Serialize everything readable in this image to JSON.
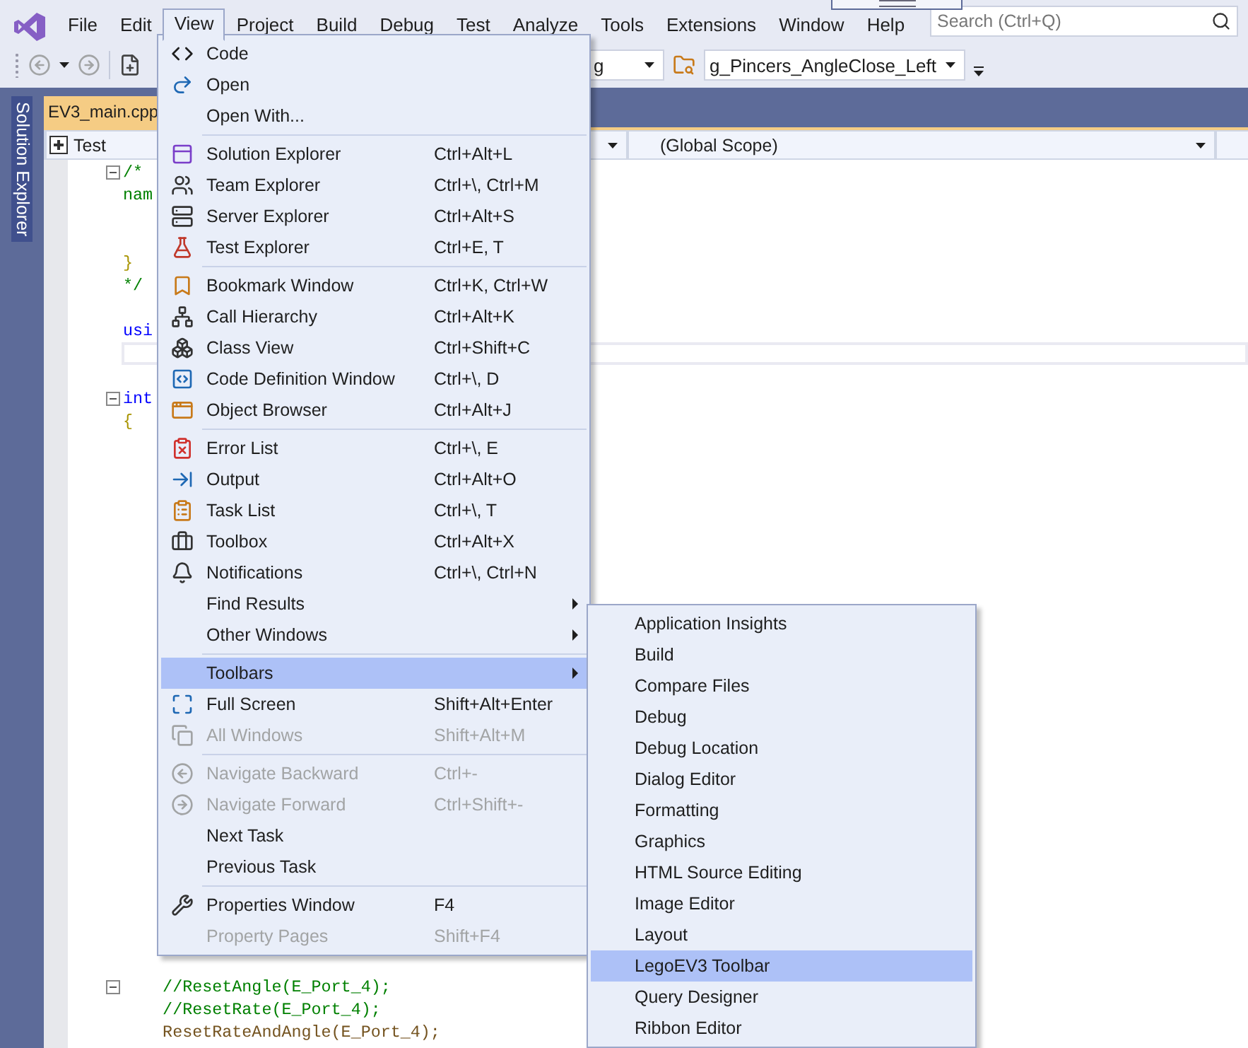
{
  "menubar": {
    "items": [
      {
        "label": "File",
        "selected": false
      },
      {
        "label": "Edit",
        "selected": false
      },
      {
        "label": "View",
        "selected": true
      },
      {
        "label": "Project",
        "selected": false
      },
      {
        "label": "Build",
        "selected": false
      },
      {
        "label": "Debug",
        "selected": false
      },
      {
        "label": "Test",
        "selected": false
      },
      {
        "label": "Analyze",
        "selected": false
      },
      {
        "label": "Tools",
        "selected": false
      },
      {
        "label": "Extensions",
        "selected": false
      },
      {
        "label": "Window",
        "selected": false
      },
      {
        "label": "Help",
        "selected": false
      }
    ]
  },
  "search": {
    "placeholder": "Search (Ctrl+Q)"
  },
  "toolbar": {
    "configuration_dropdown": {
      "value": "g"
    },
    "target_dropdown": {
      "value": "g_Pincers_AngleClose_Left"
    }
  },
  "side_tabs": [
    {
      "label": "Solution Explorer"
    }
  ],
  "document_tabs": [
    {
      "label": "EV3_main.cpp",
      "selected": true
    }
  ],
  "navigation_bar": {
    "project": "Test",
    "scope": "(Global Scope)"
  },
  "editor": {
    "lines": [
      {
        "text": "/*",
        "kind": "comment",
        "foldable": true
      },
      {
        "text": "nam",
        "kind": "comment",
        "foldable": false
      },
      {
        "kind": "blank"
      },
      {
        "kind": "blank"
      },
      {
        "text": "}",
        "kind": "brace",
        "foldable": false
      },
      {
        "text": "*/",
        "kind": "comment",
        "foldable": false
      },
      {
        "kind": "blank"
      },
      {
        "text": "usi",
        "kind": "keyword",
        "foldable": false
      },
      {
        "kind": "cursor"
      },
      {
        "kind": "blank"
      },
      {
        "text": "int",
        "kind": "keyword",
        "foldable": true
      },
      {
        "text": "{",
        "kind": "brace",
        "foldable": false
      },
      {
        "kind": "blank"
      },
      {
        "kind": "blank"
      },
      {
        "kind": "blank"
      },
      {
        "kind": "blank"
      },
      {
        "kind": "blank"
      },
      {
        "kind": "blank"
      },
      {
        "kind": "blank"
      },
      {
        "kind": "blank"
      },
      {
        "kind": "blank"
      },
      {
        "kind": "blank"
      },
      {
        "kind": "blank"
      },
      {
        "kind": "blank"
      },
      {
        "kind": "blank"
      },
      {
        "kind": "blank"
      },
      {
        "kind": "blank"
      },
      {
        "kind": "blank"
      },
      {
        "kind": "blank"
      },
      {
        "kind": "blank"
      },
      {
        "kind": "blank"
      },
      {
        "kind": "blank"
      },
      {
        "kind": "blank"
      },
      {
        "kind": "blank"
      },
      {
        "kind": "blank"
      },
      {
        "kind": "blank"
      },
      {
        "text": "    //ResetAngle(E_Port_4);",
        "kind": "comment",
        "foldable": true
      },
      {
        "text": "    //ResetRate(E_Port_4);",
        "kind": "comment",
        "foldable": false
      },
      {
        "text": "    ResetRateAndAngle(E_Port_4);",
        "kind": "function",
        "foldable": false
      }
    ]
  },
  "view_menu": {
    "items": [
      {
        "kind": "item",
        "label": "Code",
        "disabled": false,
        "submenu": false,
        "selected": false
      },
      {
        "kind": "item",
        "label": "Open",
        "disabled": false,
        "submenu": false,
        "selected": false
      },
      {
        "kind": "item",
        "label": "Open With...",
        "disabled": false,
        "submenu": false,
        "selected": false
      },
      {
        "kind": "separator"
      },
      {
        "kind": "item",
        "label": "Solution Explorer",
        "shortcut": "Ctrl+Alt+L",
        "disabled": false,
        "submenu": false,
        "selected": false
      },
      {
        "kind": "item",
        "label": "Team Explorer",
        "shortcut": "Ctrl+\\, Ctrl+M",
        "disabled": false,
        "submenu": false,
        "selected": false
      },
      {
        "kind": "item",
        "label": "Server Explorer",
        "shortcut": "Ctrl+Alt+S",
        "disabled": false,
        "submenu": false,
        "selected": false
      },
      {
        "kind": "item",
        "label": "Test Explorer",
        "shortcut": "Ctrl+E, T",
        "disabled": false,
        "submenu": false,
        "selected": false
      },
      {
        "kind": "separator"
      },
      {
        "kind": "item",
        "label": "Bookmark Window",
        "shortcut": "Ctrl+K, Ctrl+W",
        "disabled": false,
        "submenu": false,
        "selected": false
      },
      {
        "kind": "item",
        "label": "Call Hierarchy",
        "shortcut": "Ctrl+Alt+K",
        "disabled": false,
        "submenu": false,
        "selected": false
      },
      {
        "kind": "item",
        "label": "Class View",
        "shortcut": "Ctrl+Shift+C",
        "disabled": false,
        "submenu": false,
        "selected": false
      },
      {
        "kind": "item",
        "label": "Code Definition Window",
        "shortcut": "Ctrl+\\, D",
        "disabled": false,
        "submenu": false,
        "selected": false
      },
      {
        "kind": "item",
        "label": "Object Browser",
        "shortcut": "Ctrl+Alt+J",
        "disabled": false,
        "submenu": false,
        "selected": false
      },
      {
        "kind": "separator"
      },
      {
        "kind": "item",
        "label": "Error List",
        "shortcut": "Ctrl+\\, E",
        "disabled": false,
        "submenu": false,
        "selected": false
      },
      {
        "kind": "item",
        "label": "Output",
        "shortcut": "Ctrl+Alt+O",
        "disabled": false,
        "submenu": false,
        "selected": false
      },
      {
        "kind": "item",
        "label": "Task List",
        "shortcut": "Ctrl+\\, T",
        "disabled": false,
        "submenu": false,
        "selected": false
      },
      {
        "kind": "item",
        "label": "Toolbox",
        "shortcut": "Ctrl+Alt+X",
        "disabled": false,
        "submenu": false,
        "selected": false
      },
      {
        "kind": "item",
        "label": "Notifications",
        "shortcut": "Ctrl+\\, Ctrl+N",
        "disabled": false,
        "submenu": false,
        "selected": false
      },
      {
        "kind": "item",
        "label": "Find Results",
        "disabled": false,
        "submenu": true,
        "selected": false
      },
      {
        "kind": "item",
        "label": "Other Windows",
        "disabled": false,
        "submenu": true,
        "selected": false
      },
      {
        "kind": "separator"
      },
      {
        "kind": "item",
        "label": "Toolbars",
        "disabled": false,
        "submenu": true,
        "selected": true
      },
      {
        "kind": "item",
        "label": "Full Screen",
        "shortcut": "Shift+Alt+Enter",
        "disabled": false,
        "submenu": false,
        "selected": false
      },
      {
        "kind": "item",
        "label": "All Windows",
        "shortcut": "Shift+Alt+M",
        "disabled": true,
        "submenu": false,
        "selected": false
      },
      {
        "kind": "separator"
      },
      {
        "kind": "item",
        "label": "Navigate Backward",
        "shortcut": "Ctrl+-",
        "disabled": true,
        "submenu": false,
        "selected": false
      },
      {
        "kind": "item",
        "label": "Navigate Forward",
        "shortcut": "Ctrl+Shift+-",
        "disabled": true,
        "submenu": false,
        "selected": false
      },
      {
        "kind": "item",
        "label": "Next Task",
        "disabled": false,
        "submenu": false,
        "selected": false
      },
      {
        "kind": "item",
        "label": "Previous Task",
        "disabled": false,
        "submenu": false,
        "selected": false
      },
      {
        "kind": "separator"
      },
      {
        "kind": "item",
        "label": "Properties Window",
        "shortcut": "F4",
        "disabled": false,
        "submenu": false,
        "selected": false
      },
      {
        "kind": "item",
        "label": "Property Pages",
        "shortcut": "Shift+F4",
        "disabled": true,
        "submenu": false,
        "selected": false
      }
    ]
  },
  "toolbars_submenu": {
    "items": [
      {
        "label": "Application Insights",
        "selected": false
      },
      {
        "label": "Build",
        "selected": false
      },
      {
        "label": "Compare Files",
        "selected": false
      },
      {
        "label": "Debug",
        "selected": false
      },
      {
        "label": "Debug Location",
        "selected": false
      },
      {
        "label": "Dialog Editor",
        "selected": false
      },
      {
        "label": "Formatting",
        "selected": false
      },
      {
        "label": "Graphics",
        "selected": false
      },
      {
        "label": "HTML Source Editing",
        "selected": false
      },
      {
        "label": "Image Editor",
        "selected": false
      },
      {
        "label": "Layout",
        "selected": false
      },
      {
        "label": "LegoEV3 Toolbar",
        "selected": true
      },
      {
        "label": "Query Designer",
        "selected": false
      },
      {
        "label": "Ribbon Editor",
        "selected": false
      }
    ]
  }
}
